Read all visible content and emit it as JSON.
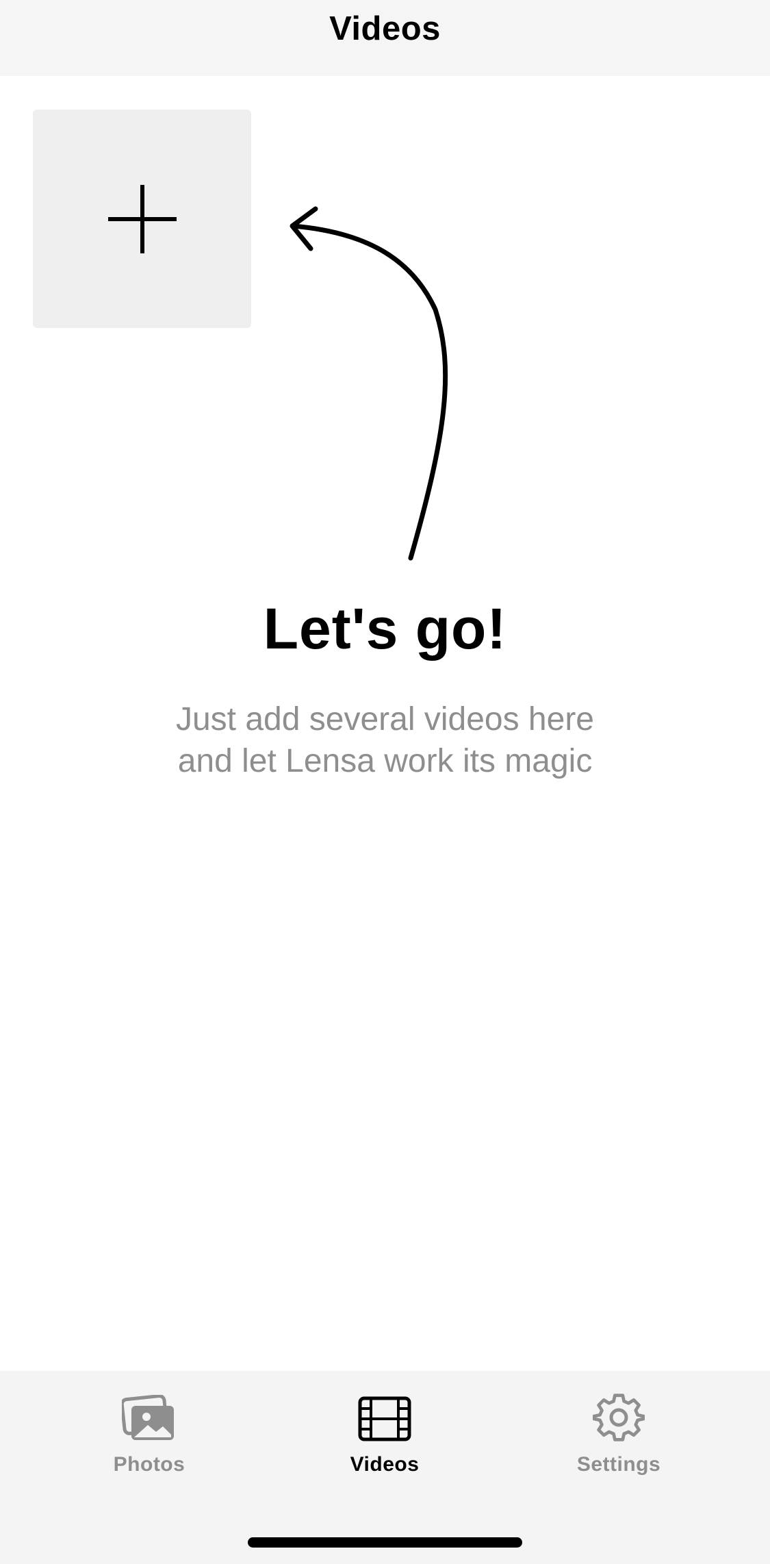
{
  "header": {
    "title": "Videos"
  },
  "main": {
    "add_tile_icon": "plus-icon",
    "hint_icon": "curved-arrow-icon",
    "empty_title": "Let's go!",
    "empty_subtitle_lines": [
      "Just add several videos here",
      "and let Lensa work its magic"
    ]
  },
  "tab_bar": {
    "active_tab": "Videos",
    "tabs": [
      {
        "label": "Photos",
        "icon": "photos-icon"
      },
      {
        "label": "Videos",
        "icon": "film-icon"
      },
      {
        "label": "Settings",
        "icon": "gear-icon"
      }
    ]
  },
  "colors": {
    "nav_background": "#f5f5f5",
    "tile_background": "#efefef",
    "text_primary": "#000000",
    "text_secondary": "#8e8e8e",
    "tab_bar_background": "#f4f4f4"
  }
}
